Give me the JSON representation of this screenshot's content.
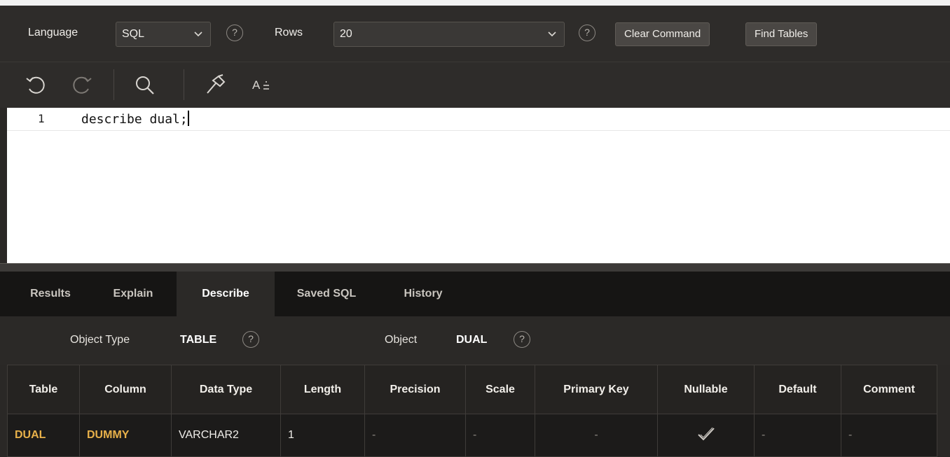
{
  "topbar": {
    "language_label": "Language",
    "language_value": "SQL",
    "rows_label": "Rows",
    "rows_value": "20",
    "clear_command_label": "Clear Command",
    "find_tables_label": "Find Tables",
    "help_glyph": "?"
  },
  "toolbar": {
    "icons": [
      "undo-icon",
      "redo-icon",
      "search-icon",
      "hammer-icon",
      "format-icon"
    ],
    "format_label": "A"
  },
  "editor": {
    "line_number": "1",
    "code": "describe dual;"
  },
  "tabs": [
    {
      "label": "Results",
      "active": false
    },
    {
      "label": "Explain",
      "active": false
    },
    {
      "label": "Describe",
      "active": true
    },
    {
      "label": "Saved SQL",
      "active": false
    },
    {
      "label": "History",
      "active": false
    }
  ],
  "describe": {
    "object_type_label": "Object Type",
    "object_type_value": "TABLE",
    "object_label": "Object",
    "object_value": "DUAL"
  },
  "table": {
    "headers": [
      "Table",
      "Column",
      "Data Type",
      "Length",
      "Precision",
      "Scale",
      "Primary Key",
      "Nullable",
      "Default",
      "Comment"
    ],
    "rows": [
      {
        "table": "DUAL",
        "column": "DUMMY",
        "data_type": "VARCHAR2",
        "length": "1",
        "precision": "-",
        "scale": "-",
        "primary_key": "-",
        "nullable": "✔",
        "default": "-",
        "comment": "-"
      }
    ]
  },
  "colors": {
    "link": "#e8b14a",
    "background": "#2a2826",
    "tab_strip": "#161514"
  }
}
